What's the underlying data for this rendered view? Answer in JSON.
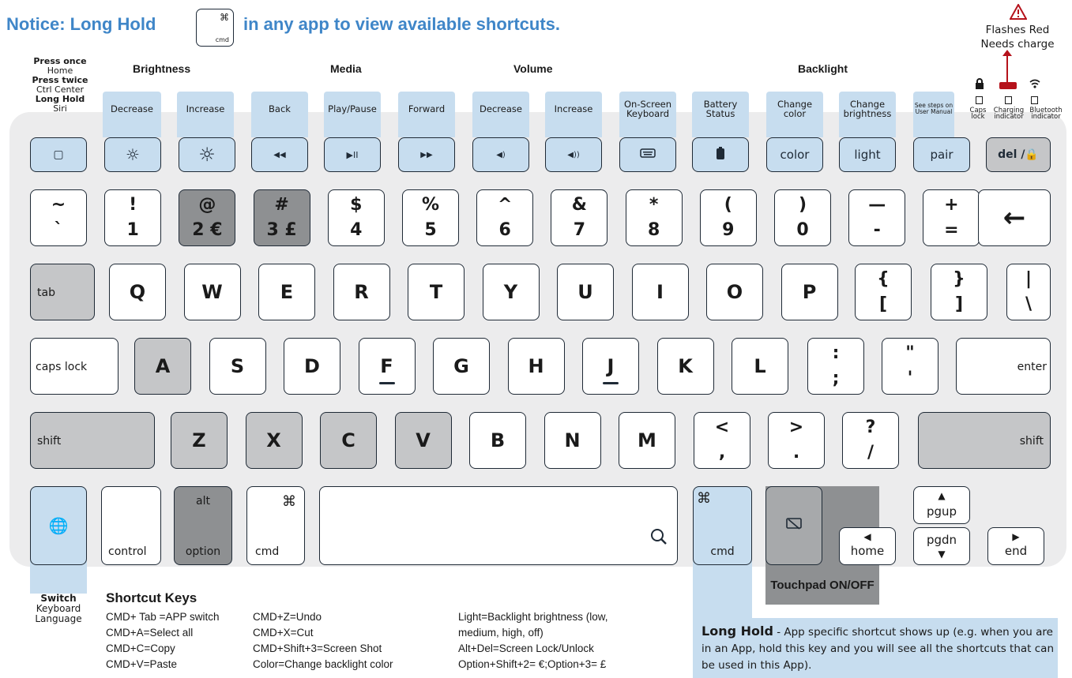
{
  "notice": {
    "pre": "Notice: Long Hold",
    "key_symbol": "⌘",
    "key_label": "cmd",
    "post": "in any app to view available shortcuts."
  },
  "indicator_note": {
    "line1": "Flashes Red",
    "line2": "Needs charge"
  },
  "home_label": {
    "l1": "Press once",
    "l2": "Home",
    "l3": "Press twice",
    "l4": "Ctrl Center",
    "l5": "Long Hold",
    "l6": "Siri"
  },
  "groups": {
    "brightness": "Brightness",
    "media": "Media",
    "volume": "Volume",
    "backlight": "Backlight"
  },
  "function_labels": {
    "b_dec": "Decrease",
    "b_inc": "Increase",
    "back": "Back",
    "play": "Play/Pause",
    "fwd": "Forward",
    "v_dec": "Decrease",
    "v_inc": "Increase",
    "osk": "On-Screen Keyboard",
    "battery": "Battery Status",
    "color": "Change color",
    "bright": "Change brightness",
    "pair_note": "See steps on User Manual"
  },
  "indicators": {
    "caps": "Caps lock",
    "charging": "Charging indicator",
    "bluetooth": "Bluetooth indicator"
  },
  "fkeys": {
    "home": "▢",
    "bdec": "☼",
    "binc": "☼",
    "back": "◀◀",
    "play": "▶II",
    "fwd": "▶▶",
    "vdec": "◀)",
    "vinc": "◀))",
    "color": "color",
    "light": "light",
    "pair": "pair",
    "del": "del /🔒"
  },
  "number_row": [
    {
      "top": "~",
      "bot": "`"
    },
    {
      "top": "!",
      "bot": "1"
    },
    {
      "top": "@",
      "bot": "2 €"
    },
    {
      "top": "#",
      "bot": "3 £"
    },
    {
      "top": "$",
      "bot": "4"
    },
    {
      "top": "%",
      "bot": "5"
    },
    {
      "top": "^",
      "bot": "6"
    },
    {
      "top": "&",
      "bot": "7"
    },
    {
      "top": "*",
      "bot": "8"
    },
    {
      "top": "(",
      "bot": "9"
    },
    {
      "top": ")",
      "bot": "0"
    },
    {
      "top": "—",
      "bot": "-"
    },
    {
      "top": "+",
      "bot": "="
    }
  ],
  "backspace": "←",
  "row_q": {
    "tab": "tab",
    "letters": [
      "Q",
      "W",
      "E",
      "R",
      "T",
      "Y",
      "U",
      "I",
      "O",
      "P"
    ],
    "lb_top": "{",
    "lb_bot": "[",
    "rb_top": "}",
    "rb_bot": "]",
    "bs_top": "|",
    "bs_bot": "\\"
  },
  "row_a": {
    "caps": "caps lock",
    "letters": [
      "A",
      "S",
      "D",
      "F",
      "G",
      "H",
      "J",
      "K",
      "L"
    ],
    "semi_top": ":",
    "semi_bot": ";",
    "quote_top": "\"",
    "quote_bot": "'",
    "enter": "enter"
  },
  "row_z": {
    "shift_l": "shift",
    "letters": [
      "Z",
      "X",
      "C",
      "V",
      "B",
      "N",
      "M"
    ],
    "lt_top": "<",
    "lt_bot": ",",
    "gt_top": ">",
    "gt_bot": ".",
    "q_top": "?",
    "q_bot": "/",
    "shift_r": "shift"
  },
  "bottom_row": {
    "globe": "🌐",
    "control": "control",
    "alt": "alt",
    "option": "option",
    "cmd_sym": "⌘",
    "cmd": "cmd",
    "search": "⚲",
    "rcmd_sym": "⌘",
    "rcmd": "cmd",
    "pgup": "pgup",
    "pgdn": "pgdn",
    "home": "home",
    "end": "end",
    "up": "▲",
    "down": "▼",
    "left": "◀",
    "right": "▶"
  },
  "touchpad_label": "Touchpad ON/OFF",
  "switch_label": {
    "l1": "Switch",
    "l2": "Keyboard",
    "l3": "Language"
  },
  "shortcuts": {
    "title": "Shortcut Keys",
    "col1": [
      "CMD+ Tab =APP switch",
      "CMD+A=Select all",
      "CMD+C=Copy",
      "CMD+V=Paste"
    ],
    "col2": [
      "CMD+Z=Undo",
      "CMD+X=Cut",
      "CMD+Shift+3=Screen Shot",
      "Color=Change backlight color"
    ],
    "col3": [
      "Light=Backlight brightness (low,",
      "medium, high, off)",
      "Alt+Del=Screen Lock/Unlock",
      "Option+Shift+2= €;Option+3= £"
    ]
  },
  "long_hold": {
    "title": "Long Hold",
    "text": " - App specific shortcut shows up (e.g. when you are in an App, hold this key and you will see all the shortcuts that can be used in this App)."
  },
  "colors": {
    "blue": "#3f86c8",
    "light_blue": "#c7ddef",
    "red": "#b5121b",
    "gray": "#c5c6c8",
    "dark_gray": "#8e9092"
  }
}
